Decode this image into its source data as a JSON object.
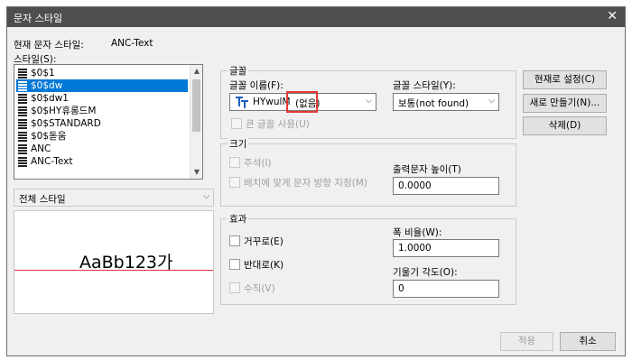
{
  "window": {
    "title": "문자 스타일",
    "close": "✕"
  },
  "current_style": {
    "label": "현재 문자 스타일:",
    "value": "ANC-Text"
  },
  "styles_label": "스타일(S):",
  "styles": [
    "$0$1",
    "$0$dw",
    "$0$dw1",
    "$0$HY휴롱드M",
    "$0$STANDARD",
    "$0$돋움",
    "ANC",
    "ANC-Text"
  ],
  "selected_style": "$0$dw",
  "filter": {
    "value": "전체 스타일"
  },
  "preview": {
    "text": "AaBb123가"
  },
  "font": {
    "group": "글꼴",
    "name_label": "글꼴 이름(F):",
    "name_value": "HYwulM",
    "name_missing": "(없음)",
    "style_label": "글꼴 스타일(Y):",
    "style_value": "보통(not found)",
    "bigfont_label": "큰 글꼴 사용(U)"
  },
  "size": {
    "group": "크기",
    "annotative_label": "주석(I)",
    "match_label": "배치에 맞게 문자 방향 지정(M)",
    "height_label": "출력문자 높이(T)",
    "height_value": "0.0000"
  },
  "effects": {
    "group": "효과",
    "upside_label": "거꾸로(E)",
    "backwards_label": "반대로(K)",
    "vertical_label": "수직(V)",
    "width_label": "폭 비율(W):",
    "width_value": "1.0000",
    "oblique_label": "기울기 각도(O):",
    "oblique_value": "0"
  },
  "buttons": {
    "set_current": "현재로 설정(C)",
    "new": "새로 만들기(N)...",
    "delete": "삭제(D)",
    "apply": "적용",
    "cancel": "취소"
  },
  "colors": {
    "selection": "#0078d7",
    "highlight_box": "#e53935",
    "baseline": "#e0304a"
  }
}
